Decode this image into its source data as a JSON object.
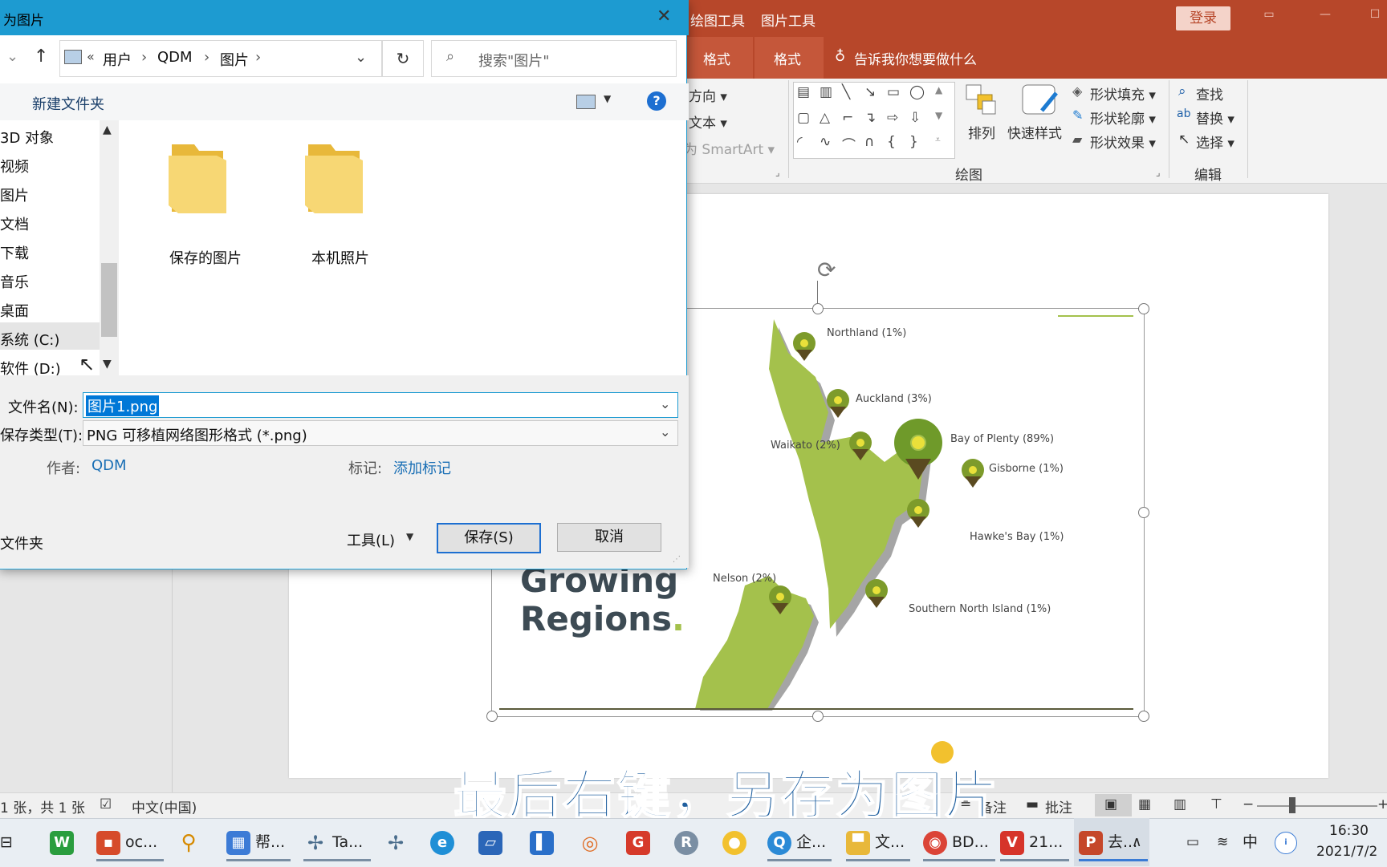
{
  "ppt": {
    "ctx_tab_drawing": "绘图工具",
    "ctx_tab_picture": "图片工具",
    "login": "登录",
    "tab_format1": "格式",
    "tab_format2": "格式",
    "tell_me": "告诉我你想要做什么",
    "ribbon": {
      "text_direction": "方向 ▾",
      "align_text": "文本 ▾",
      "smartart": "为 SmartArt ▾",
      "arrange": "排列",
      "quick_styles": "快速样式",
      "shape_fill": "形状填充 ▾",
      "shape_outline": "形状轮廓 ▾",
      "shape_effects": "形状效果 ▾",
      "find": "查找",
      "replace": "替换 ▾",
      "select": "选择 ▾",
      "group_drawing": "绘图",
      "group_editing": "编辑"
    },
    "slide": {
      "title_line1": "Growing",
      "title_line2": "Regions",
      "labels": {
        "northland": "Northland (1%)",
        "auckland": "Auckland (3%)",
        "waikato": "Waikato (2%)",
        "bay_of_plenty": "Bay of Plenty (89%)",
        "gisborne": "Gisborne (1%)",
        "hawkes_bay": "Hawke's Bay (1%)",
        "nelson": "Nelson (2%)",
        "southern_north_island": "Southern North Island (1%)"
      }
    },
    "status": {
      "slide_count": "1 张，共 1 张",
      "language": "中文(中国)",
      "notes": "备注",
      "comments": "批注"
    },
    "subtitle": "最后右键，另存为图片"
  },
  "dialog": {
    "title": "为图片",
    "breadcrumb": [
      "用户",
      "QDM",
      "图片"
    ],
    "search_placeholder": "搜索\"图片\"",
    "new_folder": "新建文件夹",
    "nav_items": [
      "3D 对象",
      "视频",
      "图片",
      "文档",
      "下载",
      "音乐",
      "桌面",
      "系统 (C:)",
      "软件 (D:)"
    ],
    "folders": [
      "保存的图片",
      "本机照片"
    ],
    "filename_label": "文件名(N):",
    "filename_value": "图片1.png",
    "filetype_label": "保存类型(T):",
    "filetype_value": "PNG 可移植网络图形格式 (*.png)",
    "author_label": "作者:",
    "author_value": "QDM",
    "tags_label": "标记:",
    "tags_value": "添加标记",
    "hide_folders": "文件夹",
    "tools": "工具(L)",
    "save": "保存(S)",
    "cancel": "取消"
  },
  "taskbar": {
    "items": [
      "oc...",
      "帮...",
      "Ta...",
      "企...",
      "文...",
      "BD...",
      "21...",
      "去..."
    ],
    "ime": "中",
    "time": "16:30",
    "date": "2021/7/2"
  },
  "colors": {
    "ppt_accent": "#b7472a",
    "dialog_accent": "#1d9bd1",
    "map_green": "#a4c14c"
  }
}
